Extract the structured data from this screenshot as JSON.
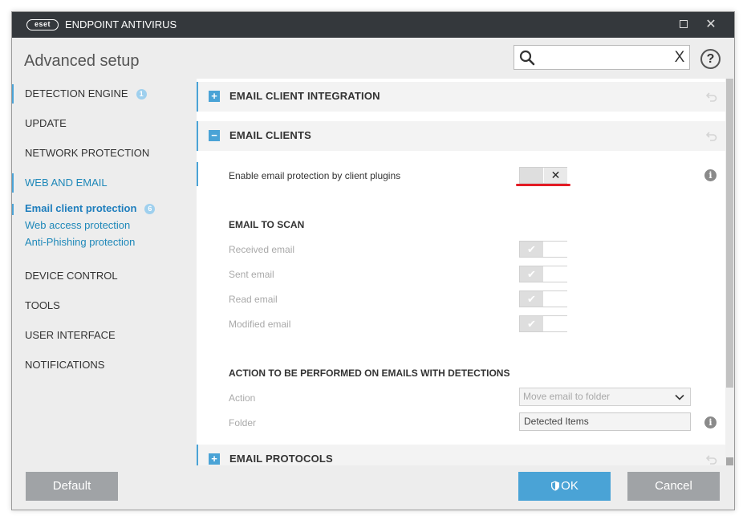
{
  "window": {
    "logo_text": "eset",
    "app_title": "ENDPOINT ANTIVIRUS",
    "maximize_label": "",
    "close_label": "✕"
  },
  "header": {
    "page_title": "Advanced setup",
    "search_value": "",
    "search_placeholder": "",
    "search_clear": "X",
    "help_label": "?"
  },
  "sidebar": {
    "items": [
      {
        "label": "DETECTION ENGINE",
        "badge": "1"
      },
      {
        "label": "UPDATE"
      },
      {
        "label": "NETWORK PROTECTION"
      },
      {
        "label": "WEB AND EMAIL"
      },
      {
        "label": "DEVICE CONTROL"
      },
      {
        "label": "TOOLS"
      },
      {
        "label": "USER INTERFACE"
      },
      {
        "label": "NOTIFICATIONS"
      }
    ],
    "subitems": [
      {
        "label": "Email client protection",
        "badge": "6",
        "selected": true
      },
      {
        "label": "Web access protection"
      },
      {
        "label": "Anti-Phishing protection"
      }
    ]
  },
  "sections": {
    "integration": {
      "title": "EMAIL CLIENT INTEGRATION",
      "toggle": "+"
    },
    "clients": {
      "title": "EMAIL CLIENTS",
      "toggle": "−"
    },
    "protocols": {
      "title": "EMAIL PROTOCOLS",
      "toggle": "+"
    }
  },
  "settings": {
    "enable_plugins": {
      "label": "Enable email protection by client plugins",
      "state": "off",
      "off_glyph": "✕"
    },
    "email_to_scan_title": "EMAIL TO SCAN",
    "scan_rows": [
      {
        "label": "Received email",
        "state": "on",
        "on_glyph": "✔"
      },
      {
        "label": "Sent email",
        "state": "on",
        "on_glyph": "✔"
      },
      {
        "label": "Read email",
        "state": "on",
        "on_glyph": "✔"
      },
      {
        "label": "Modified email",
        "state": "on",
        "on_glyph": "✔"
      }
    ],
    "action_title": "ACTION TO BE PERFORMED ON EMAILS WITH DETECTIONS",
    "action_label": "Action",
    "action_value": "Move email to folder",
    "folder_label": "Folder",
    "folder_value": "Detected Items"
  },
  "footer": {
    "default_label": "Default",
    "ok_label": "OK",
    "cancel_label": "Cancel"
  },
  "colors": {
    "accent": "#4aa3d6",
    "titlebar": "#34383c",
    "highlight": "#e31c25",
    "button_gray": "#a0a3a6"
  }
}
